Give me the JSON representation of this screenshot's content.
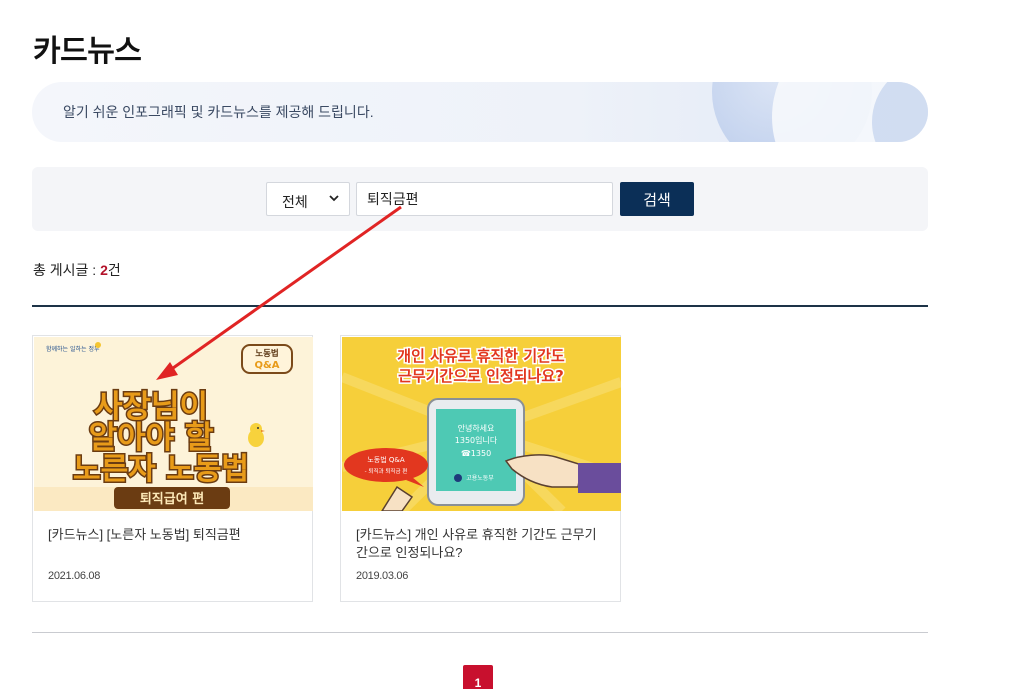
{
  "page": {
    "title": "카드뉴스",
    "intro": "알기 쉬운 인포그래픽 및 카드뉴스를 제공해 드립니다."
  },
  "search": {
    "category_selected": "전체",
    "query": "퇴직금편",
    "button_label": "검색"
  },
  "result": {
    "prefix": "총 게시글 : ",
    "count": "2",
    "suffix": "건"
  },
  "cards": [
    {
      "title": "[카드뉴스] [노른자 노동법] 퇴직금편",
      "date": "2021.06.08",
      "thumb": {
        "top_logo": "함께하는 일하는 정부",
        "badge_line1": "노동법",
        "badge_line2": "Q&A",
        "headline_1": "사장님이",
        "headline_2": "알아야 할",
        "headline_3": "노른자 노동법",
        "ribbon": "퇴직급여 편"
      }
    },
    {
      "title": "[카드뉴스] 개인 사유로 휴직한 기간도 근무기간으로 인정되나요?",
      "date": "2019.03.06",
      "thumb": {
        "headline_1": "개인 사유로 휴직한 기간도",
        "headline_2": "근무기간으로 인정되나요?",
        "phone_line1": "안녕하세요",
        "phone_line2": "1350입니다",
        "phone_line3": "☎1350",
        "phone_footer": "고용노동부",
        "bubble_line1": "노동법 Q&A",
        "bubble_line2": "- 퇴직과 퇴직금 편"
      }
    }
  ],
  "pagination": {
    "current": "1"
  },
  "colors": {
    "navy": "#0b2f57",
    "accent_red": "#c8102e",
    "annotation_arrow": "#e02424"
  }
}
